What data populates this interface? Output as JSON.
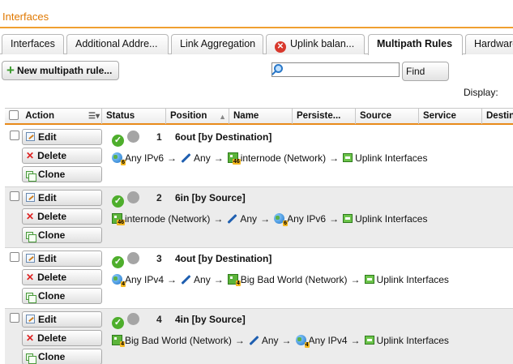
{
  "window": {
    "title": "Interfaces"
  },
  "tabs": [
    {
      "label": "Interfaces",
      "active": false
    },
    {
      "label": "Additional Addre...",
      "active": false
    },
    {
      "label": "Link Aggregation",
      "active": false
    },
    {
      "label": "Uplink balan...",
      "active": false,
      "icon": "error-icon"
    },
    {
      "label": "Multipath Rules",
      "active": true
    },
    {
      "label": "Hardware",
      "active": false
    }
  ],
  "toolbar": {
    "new_rule_label": "New multipath rule...",
    "search_value": "",
    "find_label": "Find",
    "display_label": "Display:"
  },
  "table": {
    "columns": [
      "Action",
      "Status",
      "Position",
      "Name",
      "Persiste...",
      "Source",
      "Service",
      "Destin"
    ],
    "action_labels": {
      "edit": "Edit",
      "delete": "Delete",
      "clone": "Clone"
    },
    "rows": [
      {
        "position": "1",
        "name": "6out [by Destination]",
        "flow": {
          "src_icon": "globe-icon",
          "src_badge": "6",
          "src": "Any IPv6",
          "svc": "Any",
          "dst_icon": "network-icon",
          "dst_badge": "46",
          "dst": "internode (Network)",
          "target": "Uplink Interfaces"
        }
      },
      {
        "position": "2",
        "name": "6in [by Source]",
        "flow": {
          "src_icon": "network-icon",
          "src_badge": "46",
          "src": "internode (Network)",
          "svc": "Any",
          "dst_icon": "globe-icon",
          "dst_badge": "6",
          "dst": "Any IPv6",
          "target": "Uplink Interfaces"
        }
      },
      {
        "position": "3",
        "name": "4out [by Destination]",
        "flow": {
          "src_icon": "globe-icon",
          "src_badge": "4",
          "src": "Any IPv4",
          "svc": "Any",
          "dst_icon": "network-icon",
          "dst_badge": "4",
          "dst": "Big Bad World (Network)",
          "target": "Uplink Interfaces"
        }
      },
      {
        "position": "4",
        "name": "4in [by Source]",
        "flow": {
          "src_icon": "network-icon",
          "src_badge": "4",
          "src": "Big Bad World (Network)",
          "svc": "Any",
          "dst_icon": "globe-icon",
          "dst_badge": "4",
          "dst": "Any IPv4",
          "target": "Uplink Interfaces"
        }
      }
    ]
  },
  "colors": {
    "accent": "#e88a1a",
    "status_on": "#4eae2c",
    "status_off": "#a5a5a5"
  }
}
